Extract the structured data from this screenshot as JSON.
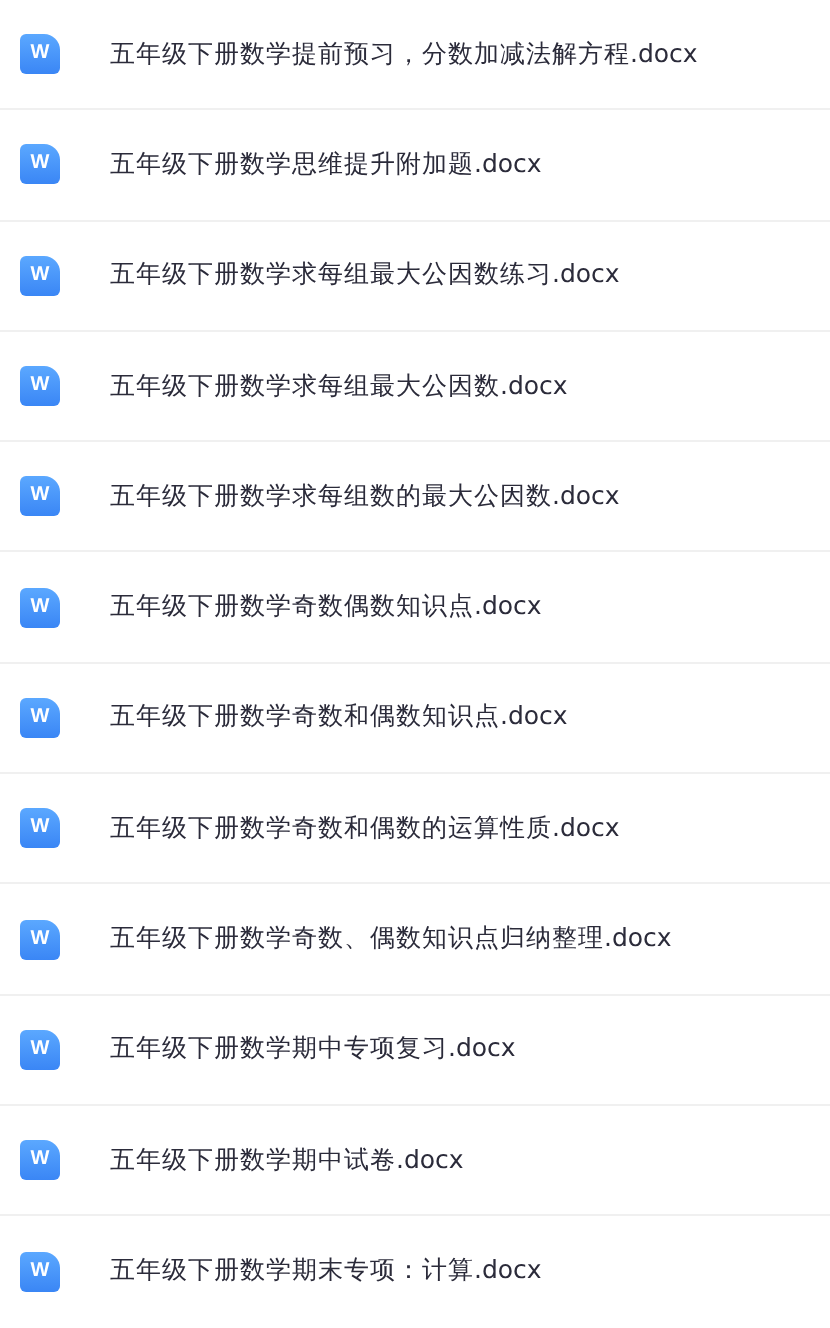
{
  "files": [
    {
      "icon_text": "W",
      "name": "五年级下册数学提前预习，分数加减法解方程.docx"
    },
    {
      "icon_text": "W",
      "name": "五年级下册数学思维提升附加题.docx"
    },
    {
      "icon_text": "W",
      "name": "五年级下册数学求每组最大公因数练习.docx"
    },
    {
      "icon_text": "W",
      "name": "五年级下册数学求每组最大公因数.docx"
    },
    {
      "icon_text": "W",
      "name": "五年级下册数学求每组数的最大公因数.docx"
    },
    {
      "icon_text": "W",
      "name": "五年级下册数学奇数偶数知识点.docx"
    },
    {
      "icon_text": "W",
      "name": "五年级下册数学奇数和偶数知识点.docx"
    },
    {
      "icon_text": "W",
      "name": "五年级下册数学奇数和偶数的运算性质.docx"
    },
    {
      "icon_text": "W",
      "name": "五年级下册数学奇数、偶数知识点归纳整理.docx"
    },
    {
      "icon_text": "W",
      "name": "五年级下册数学期中专项复习.docx"
    },
    {
      "icon_text": "W",
      "name": "五年级下册数学期中试卷.docx"
    },
    {
      "icon_text": "W",
      "name": "五年级下册数学期末专项：计算.docx"
    }
  ]
}
